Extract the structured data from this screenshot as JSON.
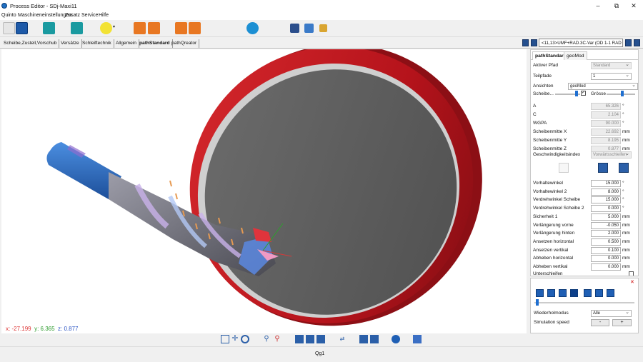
{
  "window": {
    "title": "Process Editor - SDj-Maxi11",
    "minimize": "–",
    "maximize": "⧉",
    "close": "✕"
  },
  "menu": [
    "Quinto",
    "Maschineneinstellungen",
    "Zusatz",
    "Service",
    "Hilfe"
  ],
  "tabs": [
    "Scheibe,Zustell,Vorschub",
    "Versätze",
    "Schleiftechnik",
    "Allgemein",
    "pathStandard",
    "pathQreator"
  ],
  "active_tab": "pathStandard",
  "profile_combo": "<11,13>UMF+RAD.3C-Var (OD 1-1 RAD",
  "panel": {
    "tabs": [
      "pathStandard",
      "geoMod"
    ],
    "aktiver_pfad": {
      "label": "Aktiver Pfad",
      "value": "Standard"
    },
    "teilpfade": {
      "label": "Teilpfade",
      "value": "1"
    },
    "ansichten": {
      "label": "Ansichten",
      "value": "geoMod"
    },
    "scheibe_label": "Scheibe...",
    "groesse_label": "Grösse",
    "readonly_rows": [
      {
        "label": "A",
        "value": "65.326",
        "unit": "°"
      },
      {
        "label": "C",
        "value": "2.104",
        "unit": "°"
      },
      {
        "label": "WGPA",
        "value": "90.000",
        "unit": "°"
      },
      {
        "label": "Scheibenmitte X",
        "value": "22.692",
        "unit": "mm"
      },
      {
        "label": "Scheibenmitte Y",
        "value": "8.195",
        "unit": "mm"
      },
      {
        "label": "Scheibenmitte Z",
        "value": "0.877",
        "unit": "mm"
      }
    ],
    "geschwindigkeit": {
      "label": "Geschwindigkeitsindex",
      "value": "Vorwärtsschleifen"
    },
    "edit_rows": [
      {
        "label": "Vorhaltewinkel",
        "value": "15.000",
        "unit": "°"
      },
      {
        "label": "Vorhaltewinkel 2",
        "value": "8.000",
        "unit": "°"
      },
      {
        "label": "Verdrehwinkel Scheibe",
        "value": "15.000",
        "unit": "°"
      },
      {
        "label": "Verdrehwinkel Scheibe 2",
        "value": "0.000",
        "unit": "°"
      },
      {
        "label": "Sicherheit 1",
        "value": "5.000",
        "unit": "mm"
      },
      {
        "label": "Verlängerung vorne",
        "value": "-0.050",
        "unit": "mm"
      },
      {
        "label": "Verlängerung hinten",
        "value": "2.000",
        "unit": "mm"
      },
      {
        "label": "Ansetzen horizontal",
        "value": "0.500",
        "unit": "mm"
      },
      {
        "label": "Ansetzen vertikal",
        "value": "0.100",
        "unit": "mm"
      },
      {
        "label": "Abheben horizontal",
        "value": "0.000",
        "unit": "mm"
      },
      {
        "label": "Abheben vertikal",
        "value": "0.000",
        "unit": "mm"
      }
    ],
    "cut_row": "Unterschleifen"
  },
  "simulation": {
    "wiederholmodus": {
      "label": "Wiederholmodus",
      "value": "Alle"
    },
    "speed": {
      "label": "Simulation speed",
      "minus": "-",
      "plus": "+"
    },
    "close": "✕"
  },
  "coords": {
    "x_label": "x:",
    "x": "-27.199",
    "y_label": "y:",
    "y": "6.365",
    "z_label": "z:",
    "z": "0.877"
  },
  "status": "Qg1",
  "colors": {
    "wheel_rim": "#b5131b",
    "wheel_face": "#5d5d5d",
    "tool_shank": "#2e6cc7",
    "tool_flute": "#7d7e86",
    "accent_blue": "#1f5fb4"
  }
}
